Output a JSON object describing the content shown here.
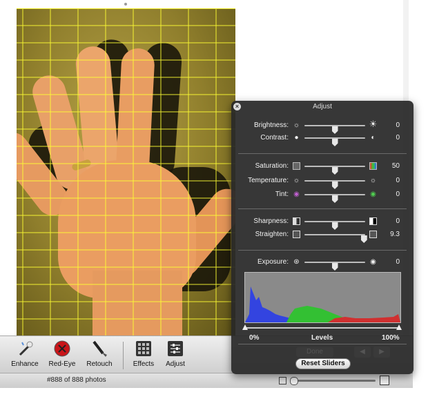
{
  "toolbar": {
    "items": [
      {
        "label": "Enhance",
        "icon": "magic-wand-icon"
      },
      {
        "label": "Red-Eye",
        "icon": "red-eye-icon"
      },
      {
        "label": "Retouch",
        "icon": "brush-icon"
      },
      {
        "label": "Effects",
        "icon": "effects-grid-icon"
      },
      {
        "label": "Adjust",
        "icon": "adjust-sliders-icon"
      }
    ]
  },
  "status": {
    "photo_count": "#888 of 888 photos"
  },
  "panel": {
    "title": "Adjust",
    "brightness": {
      "label": "Brightness:",
      "value": "0",
      "level": 0.5
    },
    "contrast": {
      "label": "Contrast:",
      "value": "0",
      "level": 0.5
    },
    "saturation": {
      "label": "Saturation:",
      "value": "50",
      "level": 0.5
    },
    "temperature": {
      "label": "Temperature:",
      "value": "0",
      "level": 0.5
    },
    "tint": {
      "label": "Tint:",
      "value": "0",
      "level": 0.5
    },
    "sharpness": {
      "label": "Sharpness:",
      "value": "0",
      "level": 0.5
    },
    "straighten": {
      "label": "Straighten:",
      "value": "9.3",
      "level": 0.98
    },
    "exposure": {
      "label": "Exposure:",
      "value": "0",
      "level": 0.5
    },
    "levels": {
      "min_label": "0%",
      "title": "Levels",
      "max_label": "100%"
    },
    "done_label": "Done",
    "reset_label": "Reset Sliders"
  },
  "colors": {
    "panel_bg": "#282828",
    "accent_grid": "#ffff33"
  }
}
